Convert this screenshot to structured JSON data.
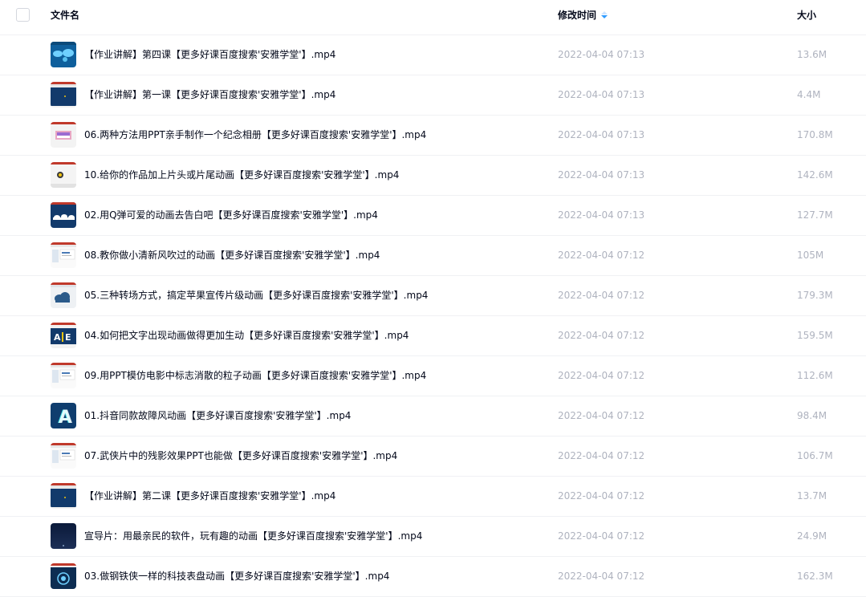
{
  "header": {
    "name_label": "文件名",
    "time_label": "修改时间",
    "size_label": "大小"
  },
  "files": [
    {
      "name": "【作业讲解】第四课【更多好课百度搜索'安雅学堂'】.mp4",
      "time": "2022-04-04 07:13",
      "size": "13.6M",
      "thumb": "world-map"
    },
    {
      "name": "【作业讲解】第一课【更多好课百度搜索'安雅学堂'】.mp4",
      "time": "2022-04-04 07:13",
      "size": "4.4M",
      "thumb": "dark-slide"
    },
    {
      "name": "06.两种方法用PPT亲手制作一个纪念相册【更多好课百度搜索'安雅学堂'】.mp4",
      "time": "2022-04-04 07:13",
      "size": "170.8M",
      "thumb": "photo-album"
    },
    {
      "name": "10.给你的作品加上片头或片尾动画【更多好课百度搜索'安雅学堂'】.mp4",
      "time": "2022-04-04 07:13",
      "size": "142.6M",
      "thumb": "circle-logo"
    },
    {
      "name": "02.用Q弹可爱的动画去告白吧【更多好课百度搜索'安雅学堂'】.mp4",
      "time": "2022-04-04 07:13",
      "size": "127.7M",
      "thumb": "cloud-dark"
    },
    {
      "name": "08.教你做小清新风吹过的动画【更多好课百度搜索'安雅学堂'】.mp4",
      "time": "2022-04-04 07:12",
      "size": "105M",
      "thumb": "light-ui"
    },
    {
      "name": "05.三种转场方式，搞定苹果宣传片级动画【更多好课百度搜索'安雅学堂'】.mp4",
      "time": "2022-04-04 07:12",
      "size": "179.3M",
      "thumb": "cloud-light"
    },
    {
      "name": "04.如何把文字出现动画做得更加生动【更多好课百度搜索'安雅学堂'】.mp4",
      "time": "2022-04-04 07:12",
      "size": "159.5M",
      "thumb": "ae-text"
    },
    {
      "name": "09.用PPT模仿电影中标志消散的粒子动画【更多好课百度搜索'安雅学堂'】.mp4",
      "time": "2022-04-04 07:12",
      "size": "112.6M",
      "thumb": "light-ui"
    },
    {
      "name": "01.抖音同款故障风动画【更多好课百度搜索'安雅学堂'】.mp4",
      "time": "2022-04-04 07:12",
      "size": "98.4M",
      "thumb": "letter-a"
    },
    {
      "name": "07.武侠片中的残影效果PPT也能做【更多好课百度搜索'安雅学堂'】.mp4",
      "time": "2022-04-04 07:12",
      "size": "106.7M",
      "thumb": "light-ui"
    },
    {
      "name": "【作业讲解】第二课【更多好课百度搜索'安雅学堂'】.mp4",
      "time": "2022-04-04 07:12",
      "size": "13.7M",
      "thumb": "dark-slide"
    },
    {
      "name": "宣导片：用最亲民的软件，玩有趣的动画【更多好课百度搜索'安雅学堂'】.mp4",
      "time": "2022-04-04 07:12",
      "size": "24.9M",
      "thumb": "dark-gradient"
    },
    {
      "name": "03.做钢铁侠一样的科技表盘动画【更多好课百度搜索'安雅学堂'】.mp4",
      "time": "2022-04-04 07:12",
      "size": "162.3M",
      "thumb": "tech-dial"
    }
  ]
}
